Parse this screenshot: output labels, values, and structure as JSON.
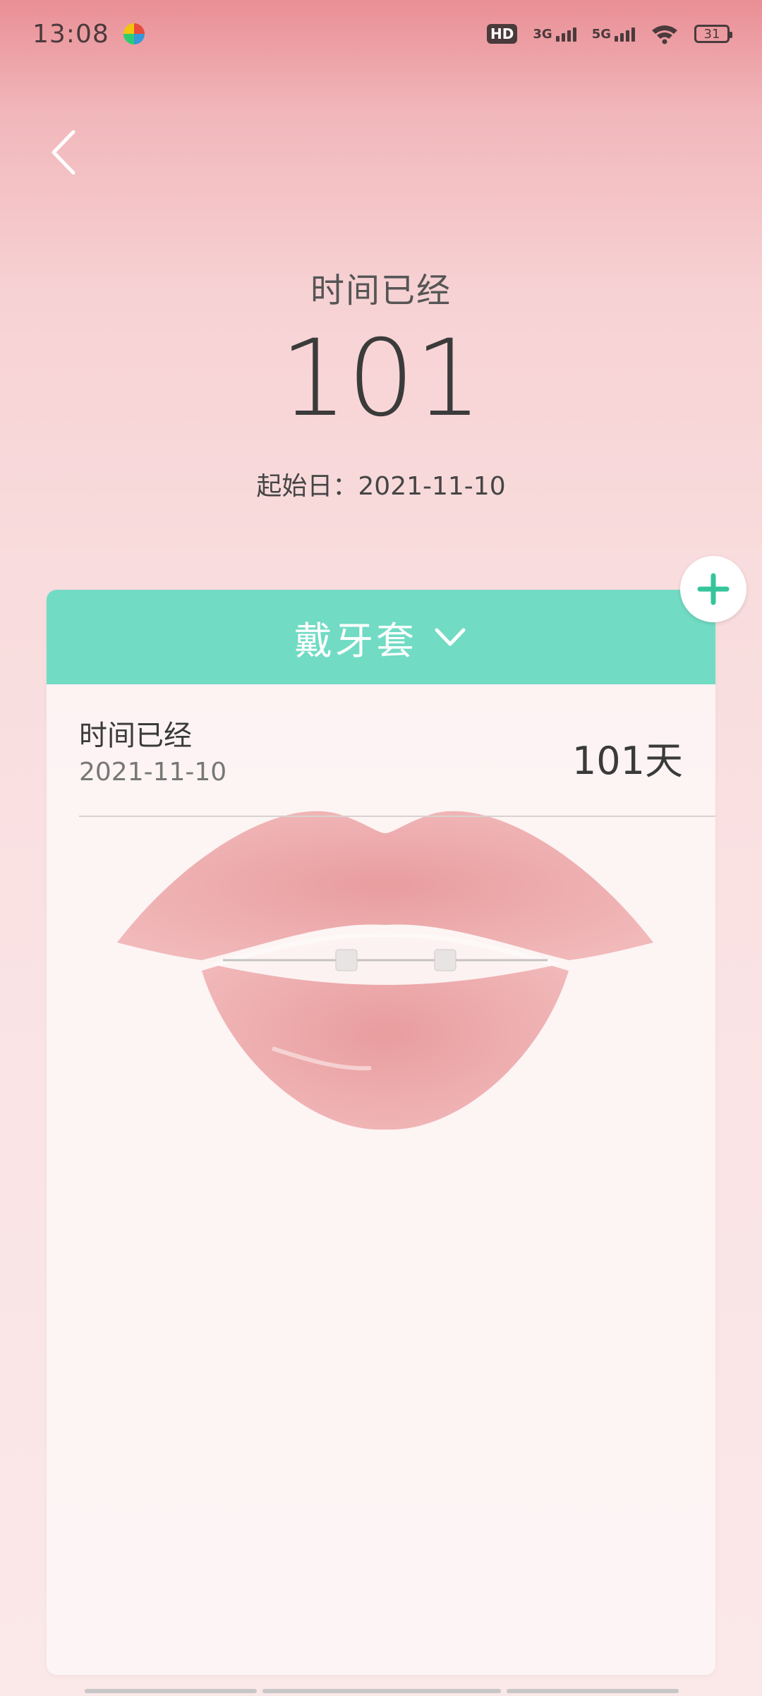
{
  "status_bar": {
    "time": "13:08",
    "hd_label": "HD",
    "network_1": "3G",
    "network_2": "5G",
    "battery": "31"
  },
  "header": {
    "subtitle": "时间已经",
    "day_count": "101",
    "start_date": "起始日：2021-11-10"
  },
  "card": {
    "category_title": "戴牙套",
    "items": [
      {
        "title": "时间已经",
        "date": "2021-11-10",
        "value": "101天"
      }
    ]
  },
  "colors": {
    "accent": "#72dbc4",
    "add_icon": "#35c59b",
    "background_top": "#e98f95",
    "background_bottom": "#fbe8e9"
  },
  "icons": {
    "back": "back-arrow-icon",
    "dropdown": "chevron-down-icon",
    "add": "plus-icon"
  }
}
